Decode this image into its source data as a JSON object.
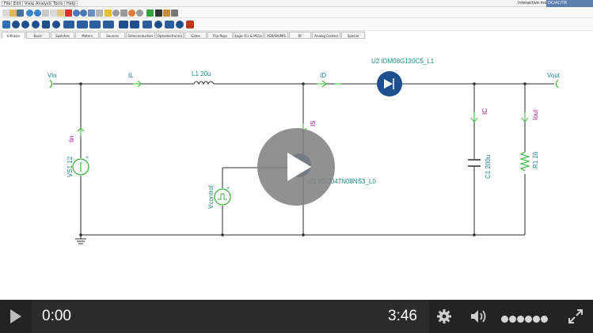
{
  "menubar": {
    "items": [
      "File",
      "Edit",
      "View",
      "Analysis",
      "Tools",
      "Help"
    ],
    "mode_label": "Interactive mode:",
    "mode_value": "DC/AC/TR"
  },
  "palette_tabs": [
    "Infinean",
    "Basic",
    "Switches",
    "Meters",
    "Sources",
    "Semiconductors",
    "Optoelectronics",
    "Gates",
    "Flip-flops",
    "Logic ICs & MCUs",
    "XOR/OA/MIS",
    "RF",
    "Analog Control",
    "Special"
  ],
  "active_tab": "Infinean",
  "schematic": {
    "nets": {
      "vin": "Vin",
      "vout": "Vout"
    },
    "currents": {
      "il": "IL",
      "id": "ID",
      "iin": "Iin",
      "is": "IS",
      "ic": "IC",
      "iout": "Iout"
    },
    "components": {
      "l1": "L1 20u",
      "u2": "U2 IDM08G120C5_L1",
      "vs1": "VS1 12",
      "u1": "U1 BSC047N08NS3_L0",
      "vcontrol": "Vcontrol",
      "c1": "C1 200u",
      "r1": "R1 16"
    },
    "colors": {
      "wire": "#2c2c2c",
      "label": "#1a8a86",
      "current": "#a0159c",
      "arrow": "#35b435",
      "diode": "#1f4f8c"
    }
  },
  "player": {
    "current_time": "0:00",
    "duration": "3:46",
    "icons": [
      "play-icon",
      "gear-icon",
      "volume-icon",
      "fullscreen-icon"
    ]
  }
}
